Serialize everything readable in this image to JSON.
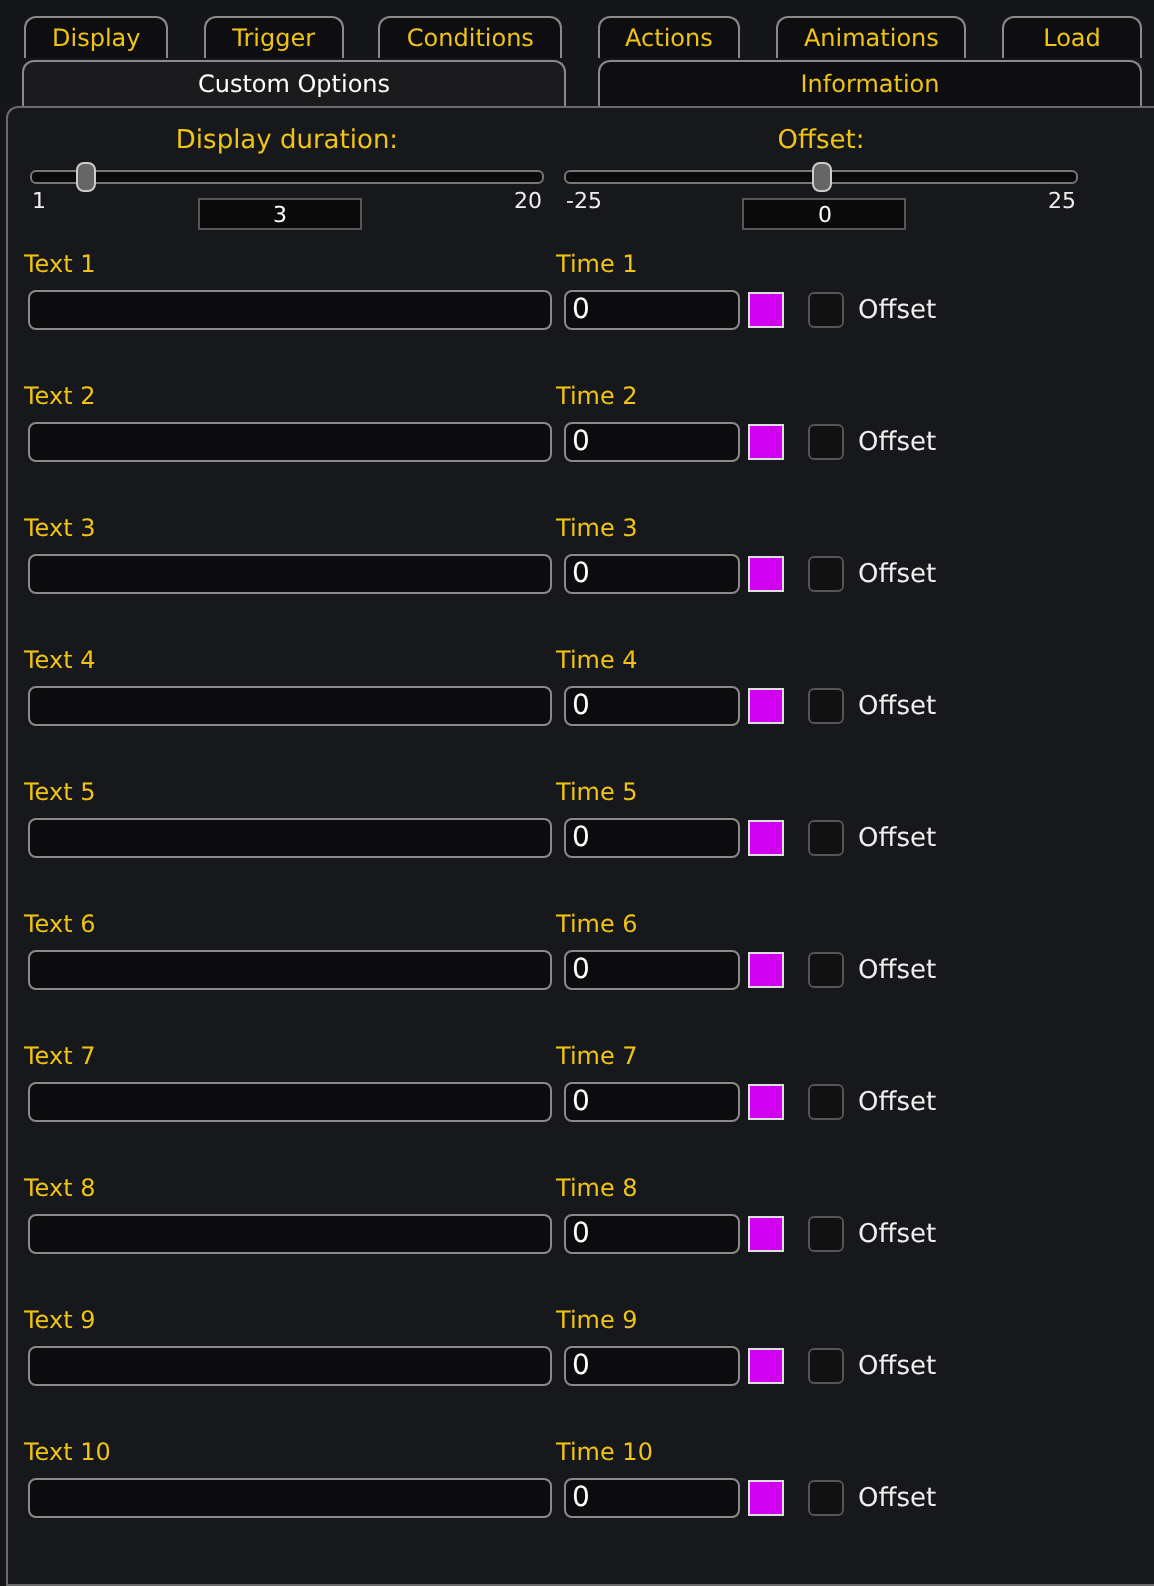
{
  "tabs_top": [
    {
      "label": "Display",
      "selected": false
    },
    {
      "label": "Trigger",
      "selected": false
    },
    {
      "label": "Conditions",
      "selected": false
    },
    {
      "label": "Actions",
      "selected": false
    },
    {
      "label": "Animations",
      "selected": false
    },
    {
      "label": "Load",
      "selected": false
    }
  ],
  "tabs_bottom": [
    {
      "label": "Custom Options",
      "selected": true
    },
    {
      "label": "Information",
      "selected": false
    }
  ],
  "sliders": [
    {
      "label": "Display duration:",
      "min": "1",
      "max": "20",
      "value": "3",
      "level": 0.105
    },
    {
      "label": "Offset:",
      "min": "-25",
      "max": "25",
      "value": "0",
      "level": 0.5
    }
  ],
  "entries": [
    {
      "text_label": "Text 1",
      "time_label": "Time 1",
      "time": "0",
      "color": "#d000f0",
      "offset_label": "Offset",
      "checked": false
    },
    {
      "text_label": "Text 2",
      "time_label": "Time 2",
      "time": "0",
      "color": "#d000f0",
      "offset_label": "Offset",
      "checked": false
    },
    {
      "text_label": "Text 3",
      "time_label": "Time 3",
      "time": "0",
      "color": "#d000f0",
      "offset_label": "Offset",
      "checked": false
    },
    {
      "text_label": "Text 4",
      "time_label": "Time 4",
      "time": "0",
      "color": "#d000f0",
      "offset_label": "Offset",
      "checked": false
    },
    {
      "text_label": "Text 5",
      "time_label": "Time 5",
      "time": "0",
      "color": "#d000f0",
      "offset_label": "Offset",
      "checked": false
    },
    {
      "text_label": "Text 6",
      "time_label": "Time 6",
      "time": "0",
      "color": "#d000f0",
      "offset_label": "Offset",
      "checked": false
    },
    {
      "text_label": "Text 7",
      "time_label": "Time 7",
      "time": "0",
      "color": "#d000f0",
      "offset_label": "Offset",
      "checked": false
    },
    {
      "text_label": "Text 8",
      "time_label": "Time 8",
      "time": "0",
      "color": "#d000f0",
      "offset_label": "Offset",
      "checked": false
    },
    {
      "text_label": "Text 9",
      "time_label": "Time 9",
      "time": "0",
      "color": "#d000f0",
      "offset_label": "Offset",
      "checked": false
    },
    {
      "text_label": "Text 10",
      "time_label": "Time 10",
      "time": "0",
      "color": "#d000f0",
      "offset_label": "Offset",
      "checked": false
    }
  ]
}
